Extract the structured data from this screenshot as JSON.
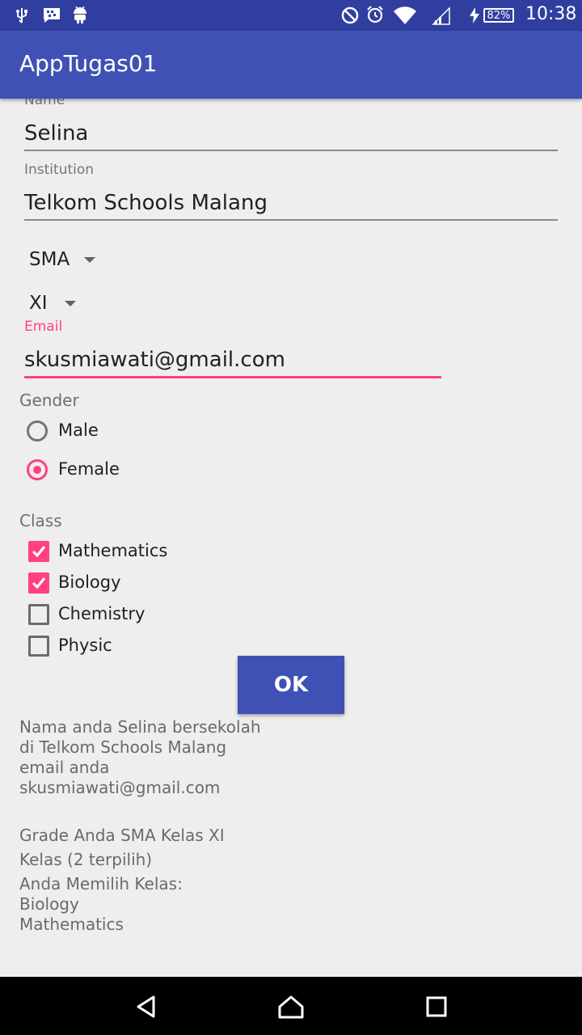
{
  "status_bar": {
    "icons": [
      "usb-icon",
      "bbm-icon",
      "android-icon",
      "do-not-disturb-icon",
      "alarm-icon",
      "wifi-icon",
      "signal-icon",
      "charging-icon"
    ],
    "battery": "82%",
    "time": "10:38"
  },
  "app_bar": {
    "title": "AppTugas01"
  },
  "form": {
    "name": {
      "label": "Name",
      "value": "Selina"
    },
    "institution": {
      "label": "Institution",
      "value": "Telkom Schools Malang"
    },
    "level_spinner": {
      "value": "SMA"
    },
    "grade_spinner": {
      "value": "XI"
    },
    "email": {
      "label": "Email",
      "value": "skusmiawati@gmail.com"
    },
    "gender": {
      "label": "Gender",
      "options": [
        {
          "label": "Male",
          "checked": false
        },
        {
          "label": "Female",
          "checked": true
        }
      ]
    },
    "class": {
      "label": "Class",
      "options": [
        {
          "label": "Mathematics",
          "checked": true
        },
        {
          "label": "Biology",
          "checked": true
        },
        {
          "label": "Chemistry",
          "checked": false
        },
        {
          "label": "Physic",
          "checked": false
        }
      ]
    },
    "ok_label": "OK"
  },
  "result": {
    "line1": "Nama anda Selina bersekolah",
    "line2": "di Telkom Schools Malang",
    "line3": "email anda",
    "line4": "skusmiawati@gmail.com",
    "grade_line": "Grade Anda SMA Kelas XI",
    "count_line": "Kelas (2 terpilih)",
    "chosen_header": "Anda Memilih Kelas:",
    "chosen": [
      "Biology",
      "Mathematics"
    ]
  },
  "colors": {
    "primary": "#3f51b5",
    "primary_dark": "#303f9f",
    "accent": "#ff4081"
  },
  "nav_bar": {
    "icons": [
      "back-icon",
      "home-icon",
      "recents-icon"
    ]
  }
}
